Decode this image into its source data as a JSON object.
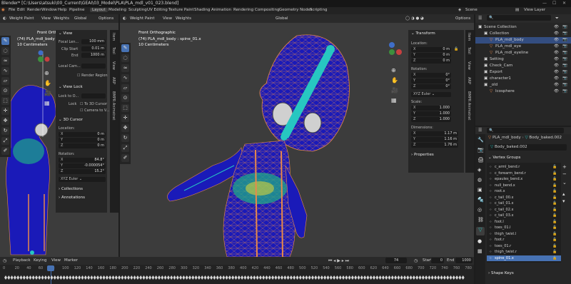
{
  "title_bar": {
    "text": "Blender* [C:\\Users\\atsuki\\00_Current\\GEAI\\03_Model\\PLA\\PLA_mdl_v01_023.blend]"
  },
  "menu": {
    "items": [
      "File",
      "Edit",
      "Render",
      "Window",
      "Help",
      "Pipeline"
    ],
    "workspaces": [
      "Layout",
      "Modeling",
      "Sculpting",
      "UV Editing",
      "Texture Paint",
      "Shading",
      "Animation",
      "Rendering",
      "Compositing",
      "Geometry Nodes",
      "Scripting"
    ],
    "active_workspace": "Layout",
    "scene": "Scene",
    "view_layer": "View Layer"
  },
  "left_viewport": {
    "mode": "Weight Paint",
    "view_menu": "View",
    "weights_menu": "Weights",
    "orientation": "Global",
    "options": "Options",
    "overlay_lines": [
      "Front Orthographic",
      "(74) PLA_mdl_body : spine_01.x",
      "10 Centimeters"
    ],
    "npanel": {
      "view_section": "View",
      "focal_length_label": "Focal Len...",
      "focal_length_value": "100 mm",
      "clip_start_label": "Clip Start",
      "clip_start_value": "0.01 m",
      "clip_end_label": "End",
      "clip_end_value": "1000 m",
      "local_camera_label": "Local Cam...",
      "render_region": "Render Region",
      "view_lock_section": "View Lock",
      "lock_to_object": "Lock to O...",
      "lock_label": "Lock",
      "to_3d_cursor": "To 3D Cursor",
      "camera_to_view": "Camera to V...",
      "cursor_section": "3D Cursor",
      "location_label": "Location:",
      "loc": [
        {
          "axis": "X",
          "value": "0 m"
        },
        {
          "axis": "Y",
          "value": "0 m"
        },
        {
          "axis": "Z",
          "value": "0 m"
        }
      ],
      "rotation_label": "Rotation:",
      "rot": [
        {
          "axis": "X",
          "value": "84.8°"
        },
        {
          "axis": "Y",
          "value": "-0.000054°"
        },
        {
          "axis": "Z",
          "value": "15.2°"
        }
      ],
      "rotation_mode": "XYZ Euler",
      "collections_section": "Collections",
      "annotations_section": "Annotations"
    },
    "side_tabs": [
      "Item",
      "Tool",
      "View",
      "ARP",
      "BMPR Animstrat"
    ]
  },
  "main_viewport": {
    "mode": "Weight Paint",
    "view_menu": "View",
    "weights_menu": "Weights",
    "orientation": "Global",
    "options": "Options",
    "overlay_lines": [
      "Front Orthographic",
      "(74) PLA_mdl_body : spine_01.x",
      "10 Centimeters"
    ],
    "npanel": {
      "transform_section": "Transform",
      "location_label": "Location:",
      "loc": [
        {
          "axis": "X",
          "value": "0 m"
        },
        {
          "axis": "Y",
          "value": "0 m"
        },
        {
          "axis": "Z",
          "value": "0 m"
        }
      ],
      "rotation_label": "Rotation:",
      "rot": [
        {
          "axis": "X",
          "value": "0°"
        },
        {
          "axis": "Y",
          "value": "0°"
        },
        {
          "axis": "Z",
          "value": "0°"
        }
      ],
      "rotation_mode": "XYZ Euler",
      "scale_label": "Scale:",
      "scale": [
        {
          "axis": "X",
          "value": "1.000"
        },
        {
          "axis": "Y",
          "value": "1.000"
        },
        {
          "axis": "Z",
          "value": "1.000"
        }
      ],
      "dimensions_label": "Dimensions:",
      "dim": [
        {
          "axis": "X",
          "value": "1.17 m"
        },
        {
          "axis": "Y",
          "value": "1.16 m"
        },
        {
          "axis": "Z",
          "value": "1.76 m"
        }
      ],
      "properties_section": "Properties"
    },
    "side_tabs": [
      "Item",
      "Tool",
      "View",
      "ARP",
      "BMPR Animstrat"
    ]
  },
  "outliner": {
    "rows": [
      {
        "name": "Scene Collection",
        "indent": 0,
        "selected": false
      },
      {
        "name": "Collection",
        "indent": 1,
        "selected": false
      },
      {
        "name": "PLA_mdl_body",
        "indent": 2,
        "selected": true
      },
      {
        "name": "PLA_mdl_eye",
        "indent": 2,
        "selected": false
      },
      {
        "name": "PLA_mdl_eyeline",
        "indent": 2,
        "selected": false
      },
      {
        "name": "Setting",
        "indent": 1,
        "selected": false
      },
      {
        "name": "Check_Cam",
        "indent": 1,
        "selected": false
      },
      {
        "name": "Export",
        "indent": 1,
        "selected": false
      },
      {
        "name": "character1",
        "indent": 1,
        "selected": false
      },
      {
        "name": "_old",
        "indent": 1,
        "selected": false
      },
      {
        "name": "Icosphere",
        "indent": 2,
        "selected": false
      }
    ]
  },
  "properties": {
    "object_name": "PLA_mdl_body",
    "mesh_name": "Body_baked.002",
    "mesh_field": "Body_baked.002",
    "vertex_groups_section": "Vertex Groups",
    "vertex_groups": [
      {
        "name": "c_arml_bend.r",
        "selected": false
      },
      {
        "name": "c_forearm_bend.r",
        "selected": false
      },
      {
        "name": "epaules_bend.x",
        "selected": false
      },
      {
        "name": "null_bend.x",
        "selected": false
      },
      {
        "name": "root.x",
        "selected": false
      },
      {
        "name": "c_tail_00.x",
        "selected": false
      },
      {
        "name": "c_tail_01.x",
        "selected": false
      },
      {
        "name": "c_tail_02.x",
        "selected": false
      },
      {
        "name": "c_tail_03.x",
        "selected": false
      },
      {
        "name": "foot.l",
        "selected": false
      },
      {
        "name": "toes_01.l",
        "selected": false
      },
      {
        "name": "thigh_twist.l",
        "selected": false
      },
      {
        "name": "foot.r",
        "selected": false
      },
      {
        "name": "toes_01.r",
        "selected": false
      },
      {
        "name": "thigh_twist.r",
        "selected": false
      },
      {
        "name": "spine_01.x",
        "selected": true
      }
    ],
    "shape_keys_section": "Shape Keys"
  },
  "timeline": {
    "playback": "Playback",
    "keying": "Keying",
    "view": "View",
    "marker": "Marker",
    "current_frame": "74",
    "start_label": "Start",
    "start_value": "0",
    "end_label": "End",
    "end_value": "1000",
    "ruler": [
      "0",
      "20",
      "40",
      "60",
      "74",
      "100",
      "120",
      "140",
      "160",
      "180",
      "200",
      "220",
      "240",
      "260",
      "280",
      "300",
      "320",
      "340",
      "360",
      "380",
      "400",
      "420",
      "440",
      "460",
      "480",
      "500",
      "520",
      "540",
      "560",
      "580",
      "600",
      "620",
      "640",
      "660",
      "680",
      "700",
      "720",
      "740",
      "760",
      "780"
    ]
  },
  "colors": {
    "accent": "#4772b3",
    "selected_row": "#334d80",
    "bone": "#27c7c1",
    "mesh_wire": "#e8894a",
    "weight_blue": "#1a1ab8"
  }
}
